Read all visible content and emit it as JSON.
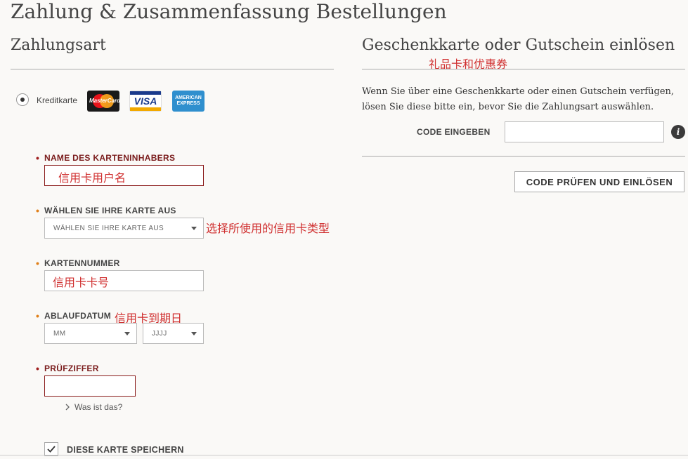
{
  "page_title": "Zahlung & Zusammenfassung Bestellungen",
  "payment": {
    "section_title": "Zahlungsart",
    "method_label": "Kreditkarte",
    "cards": {
      "mastercard": "MasterCard",
      "visa": "VISA",
      "amex_line1": "AMERICAN",
      "amex_line2": "EXPRESS"
    },
    "name_label": "NAME DES KARTENINHABERS",
    "name_annotation": "信用卡用户名",
    "card_type_label": "WÄHLEN SIE IHRE KARTE AUS",
    "card_type_selected": "WÄHLEN SIE IHRE KARTE AUS",
    "card_type_annotation": "选择所使用的信用卡类型",
    "number_label": "KARTENNUMMER",
    "number_annotation": "信用卡卡号",
    "expiry_label": "ABLAUFDATUM",
    "expiry_annotation": "信用卡到期日",
    "month_selected": "MM",
    "year_selected": "JJJJ",
    "cvv_label": "PRÜFZIFFER",
    "cvv_help_link": "Was ist das?",
    "save_card_label": "DIESE KARTE SPEICHERN"
  },
  "gift": {
    "section_title": "Geschenkkarte oder Gutschein einlösen",
    "annotation": "礼品卡和优惠券",
    "description": "Wenn Sie über eine Geschenkkarte oder einen Gutschein verfügen, lösen Sie diese bitte ein, bevor Sie die Zahlungsart auswählen.",
    "code_label": "CODE EINGEBEN",
    "code_value": "",
    "info_icon_glyph": "i",
    "redeem_button": "CODE PRÜFEN UND EINLÖSEN"
  },
  "colors": {
    "required_bullet": "#a02020",
    "optional_bullet": "#e0801a",
    "annotation": "#d03030"
  }
}
